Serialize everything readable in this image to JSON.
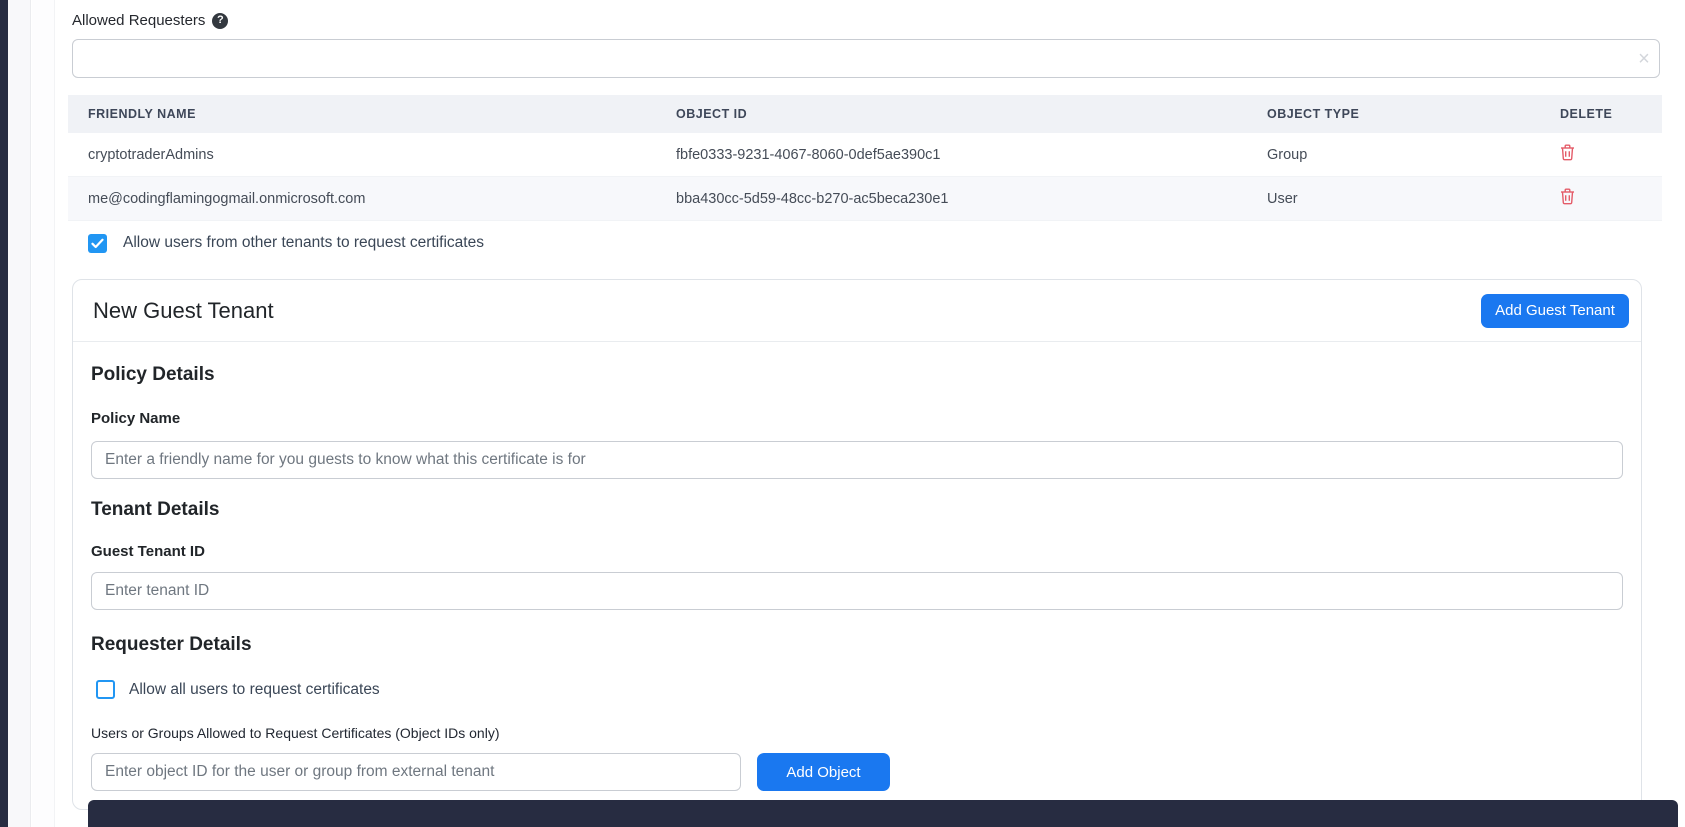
{
  "allowed_requesters": {
    "label": "Allowed Requesters",
    "help_icon": "question-mark-circle-icon",
    "input_value": "",
    "input_placeholder": "",
    "clear_icon": "×"
  },
  "requesters_table": {
    "columns": [
      "FRIENDLY NAME",
      "OBJECT ID",
      "OBJECT TYPE",
      "DELETE"
    ],
    "rows": [
      {
        "friendly_name": "cryptotraderAdmins",
        "object_id": "fbfe0333-9231-4067-8060-0def5ae390c1",
        "object_type": "Group",
        "delete_icon": "trash-icon"
      },
      {
        "friendly_name": "me@codingflamingogmail.onmicrosoft.com",
        "object_id": "bba430cc-5d59-48cc-b270-ac5beca230e1",
        "object_type": "User",
        "delete_icon": "trash-icon"
      }
    ]
  },
  "other_tenants_checkbox": {
    "label": "Allow users from other tenants to request certificates",
    "checked": true
  },
  "guest_tenant_card": {
    "title": "New Guest Tenant",
    "add_guest_tenant_button": "Add Guest Tenant",
    "policy_details": {
      "heading": "Policy Details",
      "policy_name_label": "Policy Name",
      "policy_name_value": "",
      "policy_name_placeholder": "Enter a friendly name for you guests to know what this certificate is for"
    },
    "tenant_details": {
      "heading": "Tenant Details",
      "guest_tenant_id_label": "Guest Tenant ID",
      "guest_tenant_id_value": "",
      "guest_tenant_id_placeholder": "Enter tenant ID"
    },
    "requester_details": {
      "heading": "Requester Details",
      "allow_all_checkbox": {
        "label": "Allow all users to request certificates",
        "checked": false
      },
      "object_ids_label": "Users or Groups Allowed to Request Certificates (Object IDs only)",
      "object_id_value": "",
      "object_id_placeholder": "Enter object ID for the user or group from external tenant",
      "add_object_button": "Add Object"
    }
  },
  "colors": {
    "accent_blue": "#1a78f0",
    "checkbox_blue": "#2196f3",
    "danger_red": "#e45b68",
    "dark_panel": "#272c41",
    "table_header_bg": "#f0f2f6",
    "row_alt_bg": "#f7f8fb"
  }
}
